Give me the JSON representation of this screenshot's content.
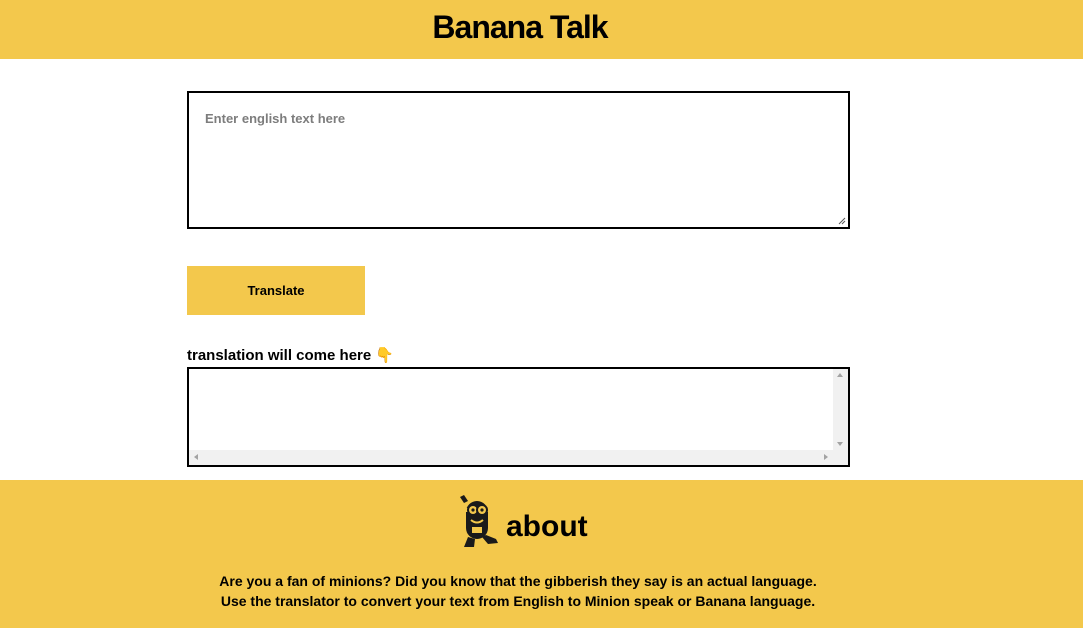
{
  "header": {
    "title": "Banana Talk"
  },
  "input": {
    "placeholder": "Enter english text here",
    "value": ""
  },
  "translate_button": {
    "label": "Translate"
  },
  "output": {
    "label": "translation will come here 👇",
    "value": ""
  },
  "about": {
    "icon": "minion-icon",
    "title": "about",
    "text": "Are you a fan of minions? Did you know that the gibberish they say is an actual language. Use the translator to convert your text from English to Minion speak or Banana language."
  },
  "colors": {
    "accent": "#f3c84c",
    "border": "#000000",
    "placeholder": "#7d7d7d",
    "scrollbar": "#f1f1f1"
  }
}
